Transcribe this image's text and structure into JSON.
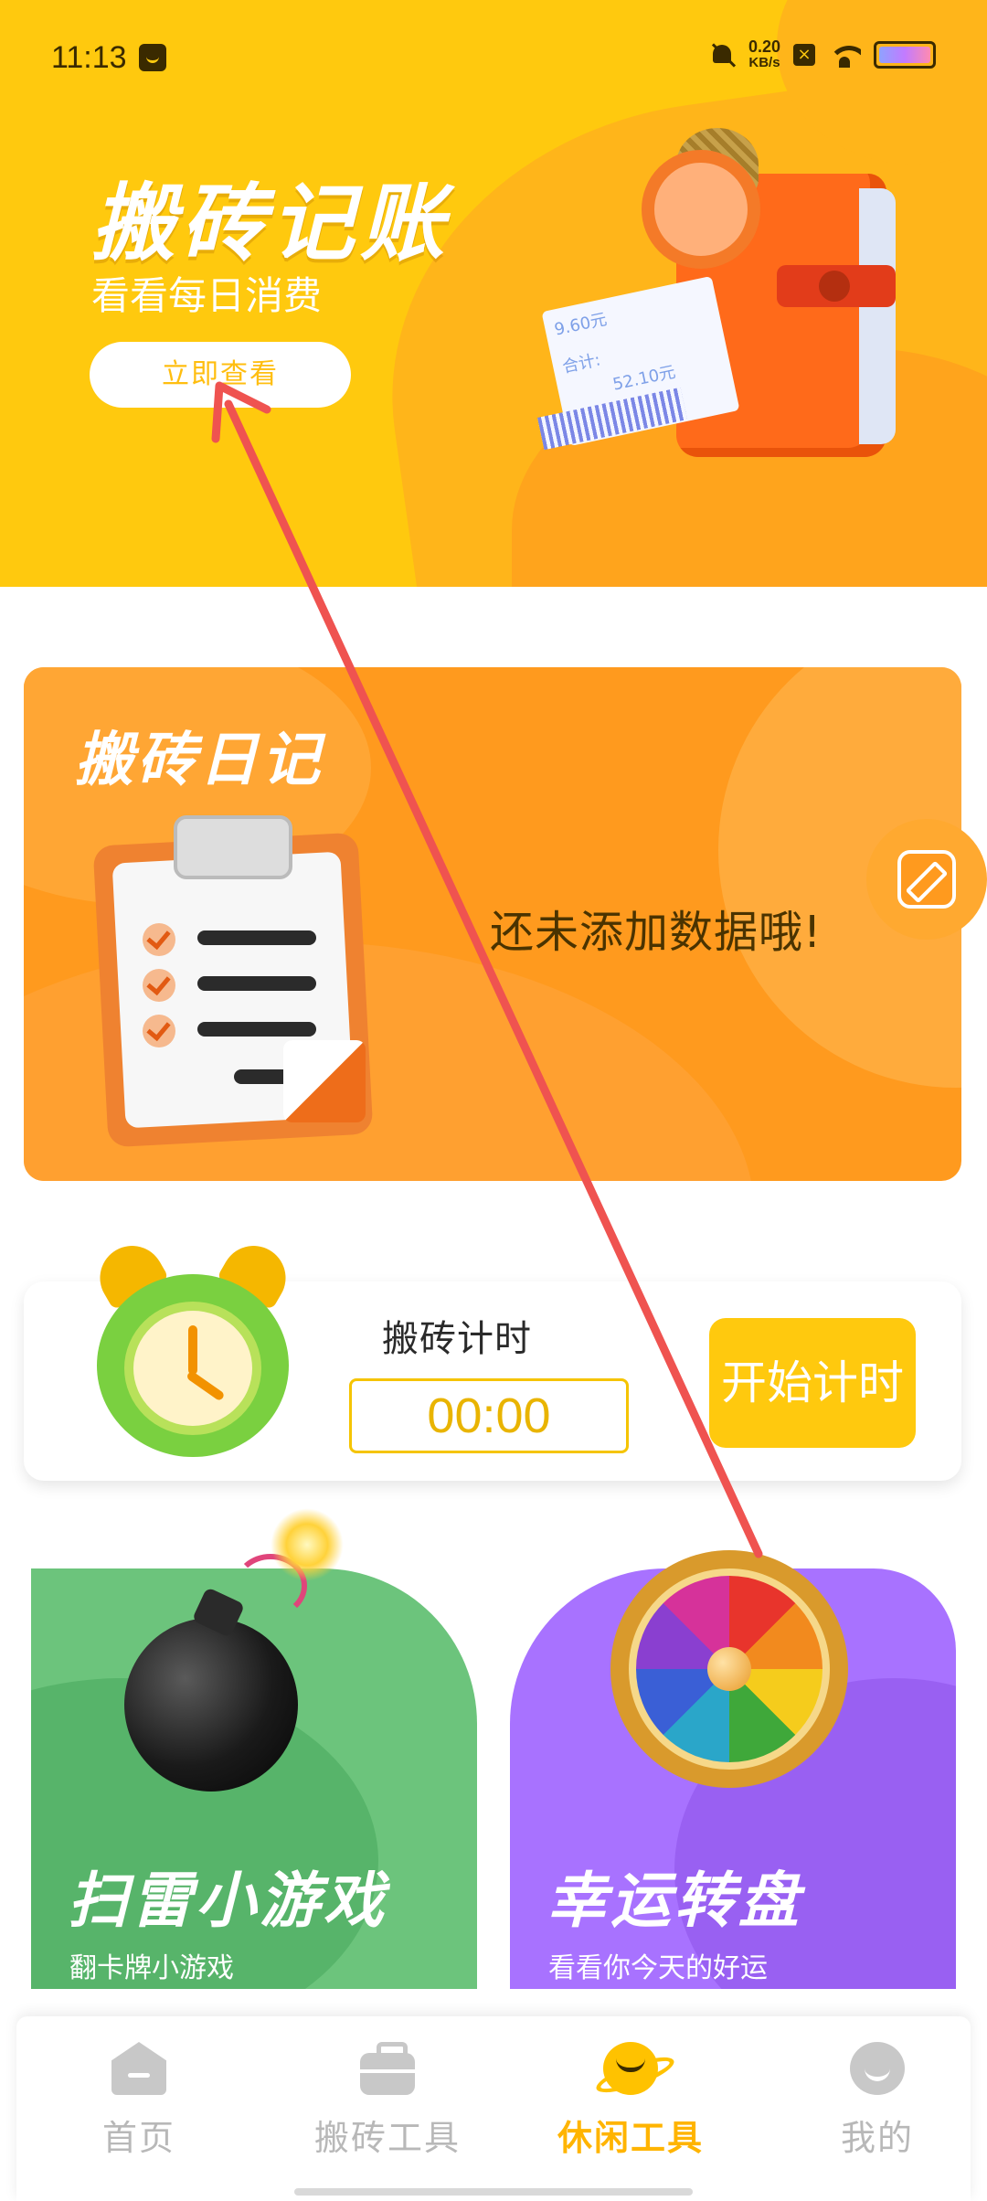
{
  "status_bar": {
    "time": "11:13",
    "net_speed_value": "0.20",
    "net_speed_unit": "KB/s"
  },
  "banner": {
    "title": "搬砖记账",
    "subtitle": "看看每日消费",
    "button_label": "立即查看",
    "receipt_line1": "9.60元",
    "receipt_line2": "合计:",
    "receipt_line3": "52.10元"
  },
  "diary": {
    "title": "搬砖日记",
    "empty_message": "还未添加数据哦!"
  },
  "timer": {
    "label": "搬砖计时",
    "value": "00:00",
    "start_label": "开始计时"
  },
  "games": [
    {
      "title": "扫雷小游戏",
      "subtitle": "翻卡牌小游戏"
    },
    {
      "title": "幸运转盘",
      "subtitle": "看看你今天的好运"
    }
  ],
  "tabs": [
    {
      "label": "首页",
      "icon": "home-icon",
      "active": false
    },
    {
      "label": "搬砖工具",
      "icon": "briefcase-icon",
      "active": false
    },
    {
      "label": "休闲工具",
      "icon": "planet-icon",
      "active": true
    },
    {
      "label": "我的",
      "icon": "face-icon",
      "active": false
    }
  ],
  "colors": {
    "brand_yellow": "#ffc90e",
    "diary_orange": "#ff9a1e",
    "mine_green": "#6cc47c",
    "wheel_purple": "#a872ff",
    "tab_active": "#ffb400",
    "tab_inactive": "#b8b8b8",
    "annotation_arrow": "#ef5350"
  }
}
